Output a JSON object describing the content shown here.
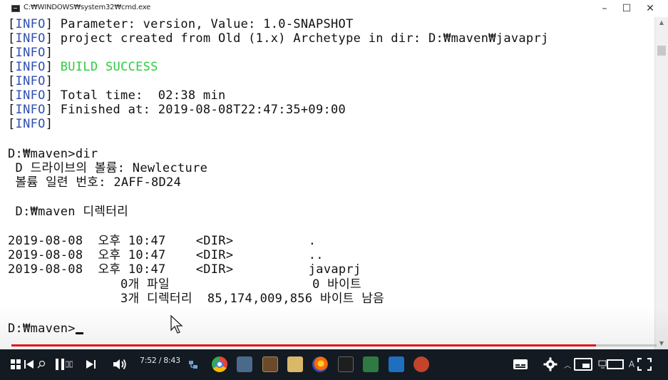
{
  "window": {
    "title": "C:₩WINDOWS₩system32₩cmd.exe",
    "minimize_glyph": "–",
    "maximize_glyph": "☐",
    "close_glyph": "✕"
  },
  "console": {
    "lines": [
      {
        "bracket_open": "[",
        "tag": "INFO",
        "bracket_close": "]",
        "text": " Parameter: version, Value: 1.0-SNAPSHOT"
      },
      {
        "bracket_open": "[",
        "tag": "INFO",
        "bracket_close": "]",
        "text": " project created from Old (1.x) Archetype in dir: D:₩maven₩javaprj"
      },
      {
        "bracket_open": "[",
        "tag": "INFO",
        "bracket_close": "]",
        "text": ""
      },
      {
        "bracket_open": "[",
        "tag": "INFO",
        "bracket_close": "]",
        "text": " BUILD SUCCESS"
      },
      {
        "bracket_open": "[",
        "tag": "INFO",
        "bracket_close": "]",
        "text": ""
      },
      {
        "bracket_open": "[",
        "tag": "INFO",
        "bracket_close": "]",
        "text": " Total time:  02:38 min"
      },
      {
        "bracket_open": "[",
        "tag": "INFO",
        "bracket_close": "]",
        "text": " Finished at: 2019-08-08T22:47:35+09:00"
      },
      {
        "bracket_open": "[",
        "tag": "INFO",
        "bracket_close": "]",
        "text": ""
      }
    ],
    "dir_command": "D:₩maven>dir",
    "volume_line": " D 드라이브의 볼륨: Newlecture",
    "serial_line": " 볼륨 일련 번호: 2AFF-8D24",
    "directory_line": " D:₩maven 디렉터리",
    "entries": [
      {
        "date": "2019-08-08",
        "ampm": "오후",
        "time": "10:47",
        "type": "<DIR>",
        "name": "."
      },
      {
        "date": "2019-08-08",
        "ampm": "오후",
        "time": "10:47",
        "type": "<DIR>",
        "name": ".."
      },
      {
        "date": "2019-08-08",
        "ampm": "오후",
        "time": "10:47",
        "type": "<DIR>",
        "name": "javaprj"
      }
    ],
    "files_summary": "               0개 파일                   0 바이트",
    "dirs_summary": "               3개 디렉터리  85,174,009,856 바이트 남음",
    "prompt": "D:₩maven>",
    "build_success_color": "#2ecc40",
    "info_tag_color": "#2f4fb0"
  },
  "player": {
    "time_display": "7:52 / 8:43",
    "progress_fraction": 0.906,
    "progress_color": "#e0141e"
  },
  "icons": {
    "play_prev": "skip-previous-icon",
    "pause": "pause-icon",
    "next": "skip-next-icon",
    "volume": "volume-icon",
    "subtitles": "subtitles-icon",
    "settings": "gear-icon",
    "miniplayer": "miniplayer-icon",
    "theater": "theater-mode-icon",
    "fullscreen": "fullscreen-icon"
  }
}
